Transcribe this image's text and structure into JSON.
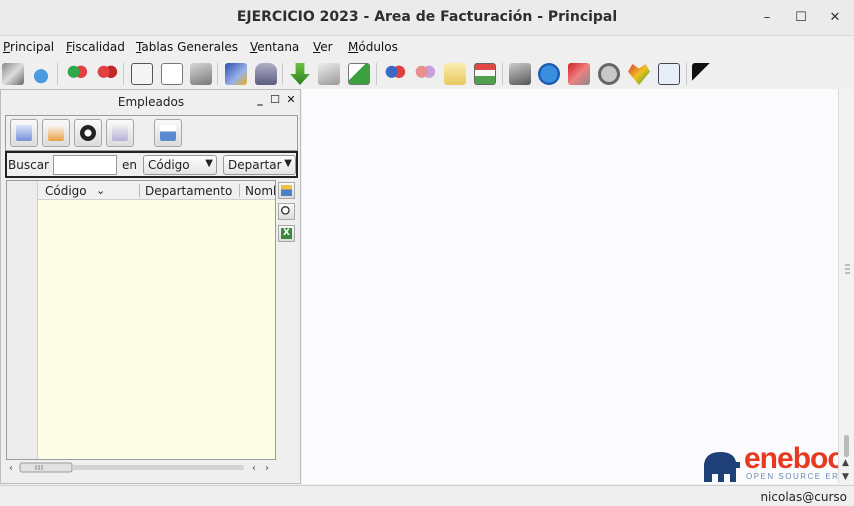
{
  "window": {
    "title": "EJERCICIO 2023 - Area de Facturación - Principal",
    "minimize_label": "–",
    "maximize_label": "☐",
    "close_label": "✕"
  },
  "menubar": [
    {
      "first": "P",
      "rest": "rincipal"
    },
    {
      "first": "F",
      "rest": "iscalidad"
    },
    {
      "first": "T",
      "rest": "ablas Generales"
    },
    {
      "first": "V",
      "rest": "entana"
    },
    {
      "first": "V",
      "rest": "er"
    },
    {
      "first": "M",
      "rest": "ódulos"
    }
  ],
  "toolbar_icons": [
    "tools-icon",
    "user-icon",
    "group-green-icon",
    "group-red-icon",
    "calendar-icon",
    "invoice-ab-icon",
    "print-icon",
    "chart-icon",
    "lock-icon",
    "down-arrow-icon",
    "document-pen-icon",
    "stairs-icon",
    "group-blue-icon",
    "group-pink-icon",
    "receipt-icon",
    "spreadsheet-icon",
    "cash-icon",
    "globe-icon",
    "tools-red-icon",
    "globe-grey-icon",
    "heart-icon",
    "text-window-icon",
    "help-cursor-icon"
  ],
  "panel": {
    "title": "Empleados",
    "min_label": "_",
    "max_label": "☐",
    "close_label": "✕"
  },
  "search": {
    "label": "Buscar",
    "value": "",
    "in_label": "en",
    "field_combo": "Código",
    "field_combo2": "Departar"
  },
  "grid": {
    "columns": [
      "Código",
      "Departamento",
      "Nomb"
    ],
    "sort_indicator": "⌄"
  },
  "logo": {
    "text": "eneboo",
    "subtext": "OPEN SOURCE ERP"
  },
  "status": {
    "user": "nicolas@curso"
  },
  "colors": {
    "grid_background": "#fdfde6",
    "logo_accent": "#e73b21"
  }
}
